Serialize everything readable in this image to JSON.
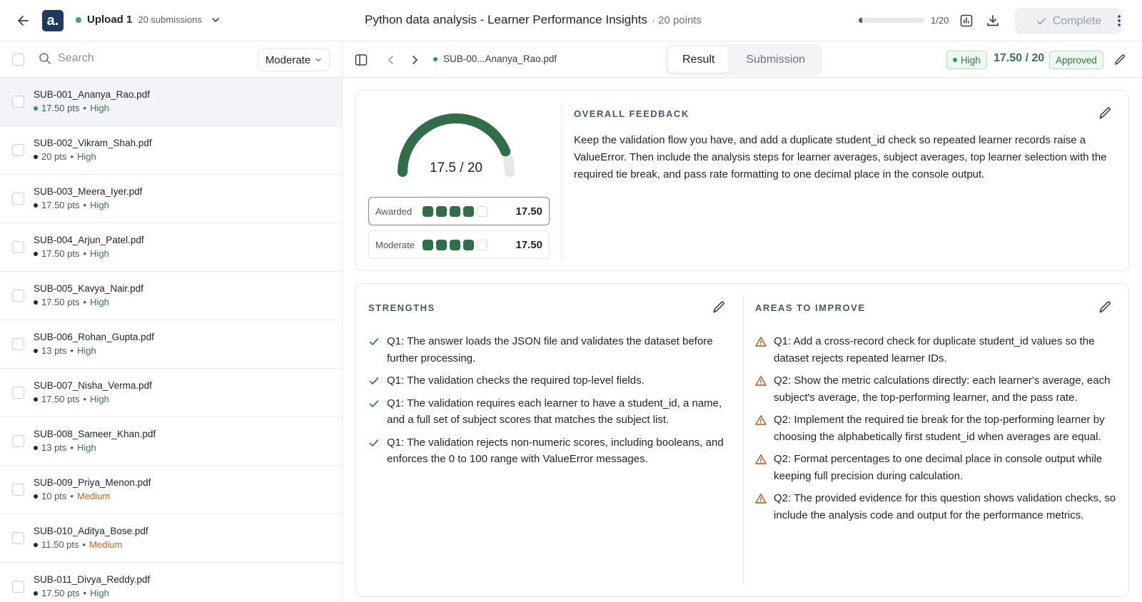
{
  "header": {
    "logo_text": "a.",
    "upload_name": "Upload 1",
    "submission_count": "20 submissions",
    "title": "Python data analysis - Learner Performance Insights",
    "points": "· 20 points",
    "progress_label": "1/20",
    "progress_value": 0.05,
    "complete_label": "Complete"
  },
  "sidebar": {
    "search_placeholder": "Search",
    "filter_value": "Moderate",
    "items": [
      {
        "name": "SUB-001_Ananya_Rao.pdf",
        "points": "17.50 pts",
        "confidence": "High"
      },
      {
        "name": "SUB-002_Vikram_Shah.pdf",
        "points": "20 pts",
        "confidence": "High"
      },
      {
        "name": "SUB-003_Meera_Iyer.pdf",
        "points": "17.50 pts",
        "confidence": "High"
      },
      {
        "name": "SUB-004_Arjun_Patel.pdf",
        "points": "17.50 pts",
        "confidence": "High"
      },
      {
        "name": "SUB-005_Kavya_Nair.pdf",
        "points": "17.50 pts",
        "confidence": "High"
      },
      {
        "name": "SUB-006_Rohan_Gupta.pdf",
        "points": "13 pts",
        "confidence": "High"
      },
      {
        "name": "SUB-007_Nisha_Verma.pdf",
        "points": "17.50 pts",
        "confidence": "High"
      },
      {
        "name": "SUB-008_Sameer_Khan.pdf",
        "points": "13 pts",
        "confidence": "High"
      },
      {
        "name": "SUB-009_Priya_Menon.pdf",
        "points": "10 pts",
        "confidence": "Medium"
      },
      {
        "name": "SUB-010_Aditya_Bose.pdf",
        "points": "11.50 pts",
        "confidence": "Medium"
      },
      {
        "name": "SUB-011_Divya_Reddy.pdf",
        "points": "17.50 pts",
        "confidence": "High"
      }
    ]
  },
  "subheader": {
    "file_name": "SUB-00...Ananya_Rao.pdf",
    "tab_result": "Result",
    "tab_submission": "Submission",
    "confidence": "High",
    "score": "17.50 / 20",
    "status": "Approved"
  },
  "result": {
    "gauge_text": "17.5 / 20",
    "gauge_value": 17.5,
    "gauge_max": 20,
    "awarded_label": "Awarded",
    "awarded_value": "17.50",
    "moderate_label": "Moderate",
    "moderate_value": "17.50",
    "pips_filled": 4,
    "pips_total": 5,
    "overall_title": "OVERALL FEEDBACK",
    "overall_text": "Keep the validation flow you have, and add a duplicate student_id check so repeated learner records raise a ValueError. Then include the analysis steps for learner averages, subject averages, top learner selection with the required tie break, and pass rate formatting to one decimal place in the console output.",
    "strengths_title": "STRENGTHS",
    "strengths": [
      "Q1: The answer loads the JSON file and validates the dataset before further processing.",
      "Q1: The validation checks the required top-level fields.",
      "Q1: The validation requires each learner to have a student_id, a name, and a full set of subject scores that matches the subject list.",
      "Q1: The validation rejects non-numeric scores, including booleans, and enforces the 0 to 100 range with ValueError messages."
    ],
    "improve_title": "AREAS TO IMPROVE",
    "improvements": [
      "Q1: Add a cross-record check for duplicate student_id values so the dataset rejects repeated learner IDs.",
      "Q2: Show the metric calculations directly: each learner's average, each subject's average, the top-performing learner, and the pass rate.",
      "Q2: Implement the required tie break for the top-performing learner by choosing the alphabetically first student_id when averages are equal.",
      "Q2: Format percentages to one decimal place in console output while keeping full precision during calculation.",
      "Q2: The provided evidence for this question shows validation checks, so include the analysis code and output for the performance metrics."
    ]
  },
  "colors": {
    "accent_green": "#2f7a4a",
    "medium_orange": "#c2640f",
    "logo_bg": "#1e3a5f"
  }
}
